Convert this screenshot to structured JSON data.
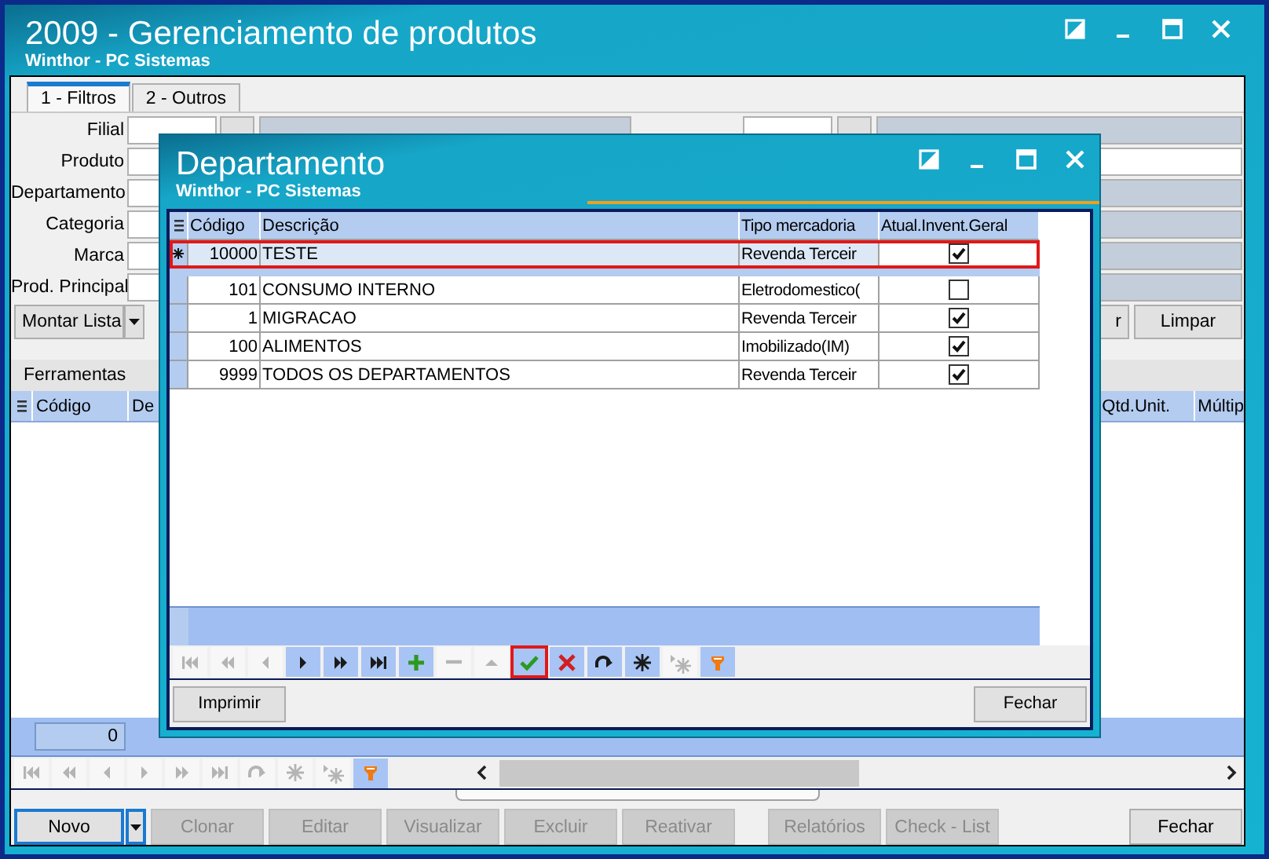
{
  "window": {
    "title": "2009 - Gerenciamento de produtos",
    "subtitle": "Winthor - PC Sistemas"
  },
  "tabs": [
    {
      "label": "1 - Filtros",
      "selected": true
    },
    {
      "label": "2 - Outros",
      "selected": false
    }
  ],
  "filters": [
    {
      "label": "Filial",
      "description_disabled": true
    },
    {
      "label": "Produto"
    },
    {
      "label": "Departamento"
    },
    {
      "label": "Categoria"
    },
    {
      "label": "Marca"
    },
    {
      "label": "Prod. Principal"
    }
  ],
  "right_fields": [
    {
      "kind": "lookup",
      "disabled": true
    },
    {
      "kind": "text",
      "disabled": false
    },
    {
      "kind": "text",
      "disabled": true
    },
    {
      "kind": "text",
      "disabled": true
    },
    {
      "kind": "text",
      "disabled": true
    },
    {
      "kind": "text",
      "disabled": true
    }
  ],
  "build_list_button": {
    "label": "Montar Lista",
    "has_menu": true
  },
  "filter_actions": [
    {
      "label": "r"
    },
    {
      "label": "Limpar"
    }
  ],
  "lower_tabs": [
    {
      "label": "Ferramentas"
    }
  ],
  "grid": {
    "columns_left": [
      "Código",
      "De"
    ],
    "columns_right": [
      "Qtd.Unit.",
      "Múltip"
    ],
    "footer_count": "0",
    "navigator": [
      {
        "kind": "first",
        "disabled": true
      },
      {
        "kind": "prior_page",
        "disabled": true
      },
      {
        "kind": "prior",
        "disabled": true
      },
      {
        "kind": "next",
        "disabled": true
      },
      {
        "kind": "next_page",
        "disabled": true
      },
      {
        "kind": "last",
        "disabled": true
      },
      {
        "kind": "refresh",
        "disabled": true
      },
      {
        "kind": "bookmark",
        "disabled": true
      },
      {
        "kind": "goto_bookmark",
        "disabled": true
      },
      {
        "kind": "filter",
        "disabled": false
      }
    ]
  },
  "actions": [
    {
      "kind": "primary",
      "label": "Novo",
      "disabled": false,
      "default": true,
      "has_menu": true
    },
    {
      "kind": "action",
      "label": "Clonar",
      "disabled": true
    },
    {
      "kind": "action",
      "label": "Editar",
      "disabled": true
    },
    {
      "kind": "action",
      "label": "Visualizar",
      "disabled": true
    },
    {
      "kind": "action",
      "label": "Excluir",
      "disabled": true
    },
    {
      "kind": "action",
      "label": "Reativar",
      "disabled": true
    },
    {
      "kind": "report",
      "label": "Relatórios",
      "disabled": true
    },
    {
      "kind": "report",
      "label": "Check - List",
      "disabled": true
    },
    {
      "kind": "close",
      "label": "Fechar",
      "disabled": false
    }
  ],
  "dialog": {
    "title": "Departamento",
    "subtitle": "Winthor - PC Sistemas",
    "columns": [
      "Código",
      "Descrição",
      "Tipo mercadoria",
      "Atual.Invent.Geral"
    ],
    "rows": [
      {
        "new": true,
        "selected": true,
        "code": "10000",
        "description": "TESTE",
        "type": "Revenda Terceir",
        "checked": true
      },
      {
        "new": false,
        "selected": false,
        "code": "101",
        "description": "CONSUMO INTERNO",
        "type": "Eletrodomestico(",
        "checked": false
      },
      {
        "new": false,
        "selected": false,
        "code": "1",
        "description": "MIGRACAO",
        "type": "Revenda Terceir",
        "checked": true
      },
      {
        "new": false,
        "selected": false,
        "code": "100",
        "description": "ALIMENTOS",
        "type": "Imobilizado(IM)",
        "checked": true
      },
      {
        "new": false,
        "selected": false,
        "code": "9999",
        "description": "TODOS OS DEPARTAMENTOS",
        "type": "Revenda Terceir",
        "checked": true
      }
    ],
    "navigator": [
      {
        "kind": "first",
        "disabled": true
      },
      {
        "kind": "prior_page",
        "disabled": true
      },
      {
        "kind": "prior",
        "disabled": true
      },
      {
        "kind": "next",
        "disabled": false
      },
      {
        "kind": "next_page",
        "disabled": false
      },
      {
        "kind": "last",
        "disabled": false
      },
      {
        "kind": "insert",
        "disabled": false
      },
      {
        "kind": "delete",
        "disabled": true
      },
      {
        "kind": "edit",
        "disabled": true
      },
      {
        "kind": "post",
        "disabled": false,
        "highlighted": true
      },
      {
        "kind": "cancel",
        "disabled": false
      },
      {
        "kind": "refresh",
        "disabled": false
      },
      {
        "kind": "bookmark",
        "disabled": false
      },
      {
        "kind": "goto_bookmark",
        "disabled": true
      },
      {
        "kind": "filter",
        "disabled": false
      }
    ],
    "buttons": [
      {
        "label": "Imprimir"
      },
      {
        "label": "Fechar"
      }
    ]
  }
}
